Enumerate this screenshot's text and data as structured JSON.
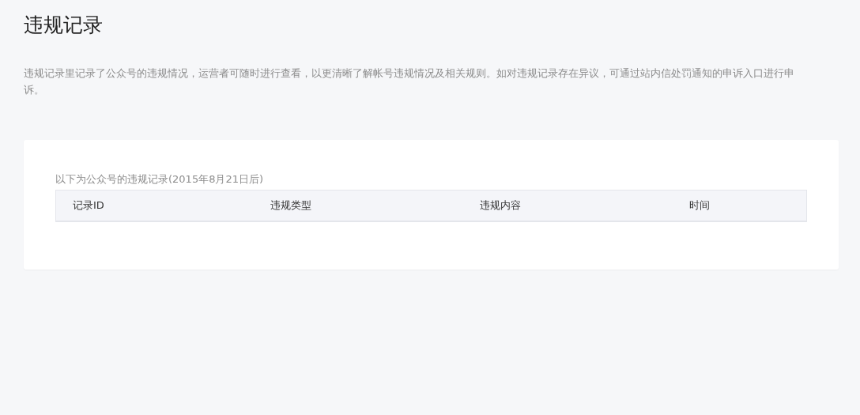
{
  "title": "违规记录",
  "description": "违规记录里记录了公众号的违规情况，运营者可随时进行查看，以更清晰了解帐号违规情况及相关规则。如对违规记录存在异议，可通过站内信处罚通知的申诉入口进行申诉。",
  "card": {
    "caption": "以下为公众号的违规记录(2015年8月21日后)",
    "table": {
      "columns": [
        "记录ID",
        "违规类型",
        "违规内容",
        "时间"
      ]
    }
  }
}
